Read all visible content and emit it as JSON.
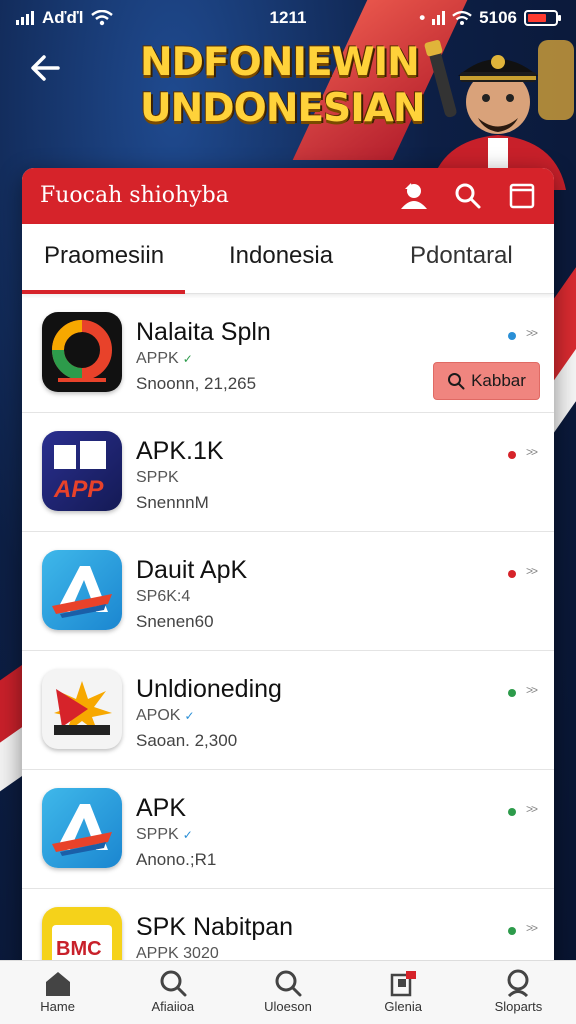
{
  "status_bar": {
    "carrier": "Aďďl",
    "time": "1211",
    "right_text": "5106"
  },
  "banner": {
    "line1": "NDFONIEWIN",
    "line2": "UNDONESIAN"
  },
  "card": {
    "title": "Fuocah shiohyba",
    "accent": "#d6232a"
  },
  "tabs": [
    {
      "label": "Praomesiin"
    },
    {
      "label": "Indonesia"
    },
    {
      "label": "Pdontaral"
    }
  ],
  "apps": [
    {
      "name": "Nalaita Spln",
      "sub": "APPK",
      "meta": "Snoonn, 21,265",
      "dot_color": "#2a8fd6",
      "action": "Kabbar",
      "icon": "colorful-ring-icon"
    },
    {
      "name": "APK.1K",
      "sub": "SPPK",
      "meta": "SnennnM",
      "dot_color": "#d6232a",
      "icon": "app-logo-icon"
    },
    {
      "name": "Dauit ApK",
      "sub": "SP6K:4",
      "meta": "Snenen60",
      "dot_color": "#d6232a",
      "icon": "a-logo-icon"
    },
    {
      "name": "Unldioneding",
      "sub": "APOK",
      "meta": "Saoan. 2,300",
      "dot_color": "#2d9b4b",
      "icon": "starburst-icon"
    },
    {
      "name": "APK",
      "sub": "SPPK",
      "meta": "Anono.;R1",
      "dot_color": "#2d9b4b",
      "icon": "a-logo-icon"
    },
    {
      "name": "SPK Nabitpan",
      "sub": "APPK",
      "meta": "3020",
      "dot_color": "#2d9b4b",
      "icon": "yellow-app-icon"
    }
  ],
  "bottom_nav": [
    {
      "label": "Hame",
      "icon": "home-icon"
    },
    {
      "label": "Afiaiioa",
      "icon": "search-icon"
    },
    {
      "label": "Uloeson",
      "icon": "search-icon"
    },
    {
      "label": "Glenia",
      "icon": "library-icon"
    },
    {
      "label": "Sloparts",
      "icon": "search-icon"
    }
  ]
}
